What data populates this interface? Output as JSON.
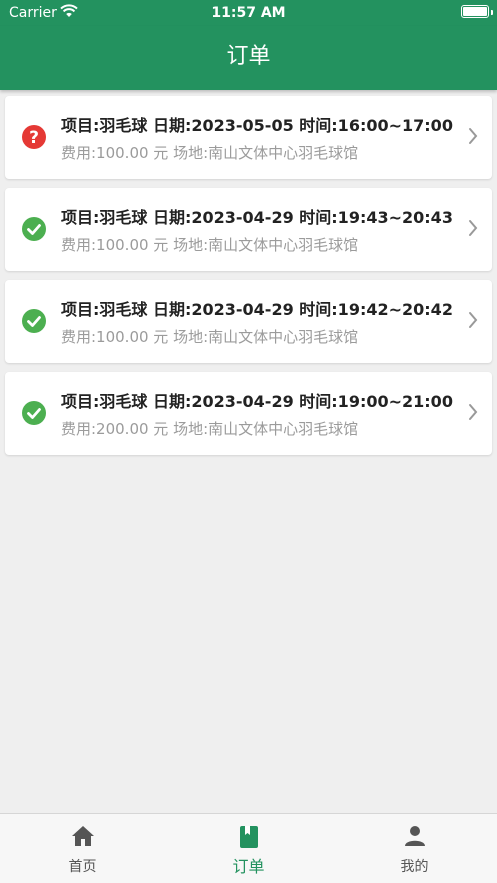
{
  "status_bar": {
    "carrier": "Carrier",
    "time": "11:57 AM"
  },
  "nav": {
    "title": "订单"
  },
  "colors": {
    "primary": "#23925f",
    "pending": "#e53935",
    "completed": "#4caf50"
  },
  "orders": [
    {
      "status": "pending",
      "icon": "question-icon",
      "line1": "项目:羽毛球  日期:2023-05-05 时间:16:00~17:00",
      "line2": "费用:100.00 元  场地:南山文体中心羽毛球馆"
    },
    {
      "status": "completed",
      "icon": "check-icon",
      "line1": "项目:羽毛球  日期:2023-04-29 时间:19:43~20:43",
      "line2": "费用:100.00 元  场地:南山文体中心羽毛球馆"
    },
    {
      "status": "completed",
      "icon": "check-icon",
      "line1": "项目:羽毛球  日期:2023-04-29 时间:19:42~20:42",
      "line2": "费用:100.00 元  场地:南山文体中心羽毛球馆"
    },
    {
      "status": "completed",
      "icon": "check-icon",
      "line1": "项目:羽毛球  日期:2023-04-29 时间:19:00~21:00",
      "line2": "费用:200.00 元  场地:南山文体中心羽毛球馆"
    }
  ],
  "tabs": [
    {
      "label": "首页",
      "icon": "home-icon",
      "active": false
    },
    {
      "label": "订单",
      "icon": "book-icon",
      "active": true
    },
    {
      "label": "我的",
      "icon": "person-icon",
      "active": false
    }
  ]
}
